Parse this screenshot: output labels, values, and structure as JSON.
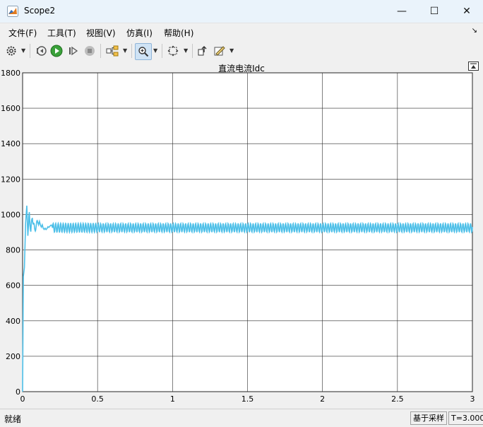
{
  "window": {
    "title": "Scope2",
    "minimize_glyph": "—",
    "maximize_glyph": "☐",
    "close_glyph": "✕"
  },
  "menu": [
    "文件(F)",
    "工具(T)",
    "视图(V)",
    "仿真(I)",
    "帮助(H)"
  ],
  "toolbar_icons": [
    "settings-icon",
    "step-back-icon",
    "run-icon",
    "step-forward-icon",
    "stop-icon",
    "signal-selector-icon",
    "zoom-in-icon",
    "autoscale-icon",
    "highlight-block-icon",
    "style-icon"
  ],
  "status": {
    "left": "就绪",
    "mode": "基于采样",
    "time": "T=3.000"
  },
  "colors": {
    "signal": "#4cbfe8",
    "axes_bg": "#ffffff",
    "grid": "#2b2b2b"
  },
  "chart_data": {
    "type": "line",
    "title": "直流电流Idc",
    "xlabel": "",
    "ylabel": "",
    "xlim": [
      0,
      3
    ],
    "ylim": [
      0,
      1800
    ],
    "xticks": [
      0,
      0.5,
      1,
      1.5,
      2,
      2.5,
      3
    ],
    "xtick_labels": [
      "0",
      "0.5",
      "1",
      "1.5",
      "2",
      "2.5",
      "3"
    ],
    "yticks": [
      0,
      200,
      400,
      600,
      800,
      1000,
      1200,
      1400,
      1600,
      1800
    ],
    "ytick_labels": [
      "0",
      "200",
      "400",
      "600",
      "800",
      "1000",
      "1200",
      "1400",
      "1600",
      "1800"
    ],
    "grid": true,
    "series": [
      {
        "x": [
          0,
          0.005,
          0.012,
          0.02,
          0.028,
          0.035,
          0.045,
          0.055,
          0.065,
          0.08,
          0.1,
          0.15,
          0.2,
          0.5,
          1.0,
          1.5,
          2.0,
          2.5,
          3.0
        ],
        "y": [
          0,
          650,
          700,
          950,
          1050,
          880,
          1010,
          900,
          990,
          910,
          960,
          915,
          945,
          930,
          930,
          930,
          930,
          930,
          930
        ],
        "band_low": 900,
        "band_high": 950
      }
    ]
  }
}
